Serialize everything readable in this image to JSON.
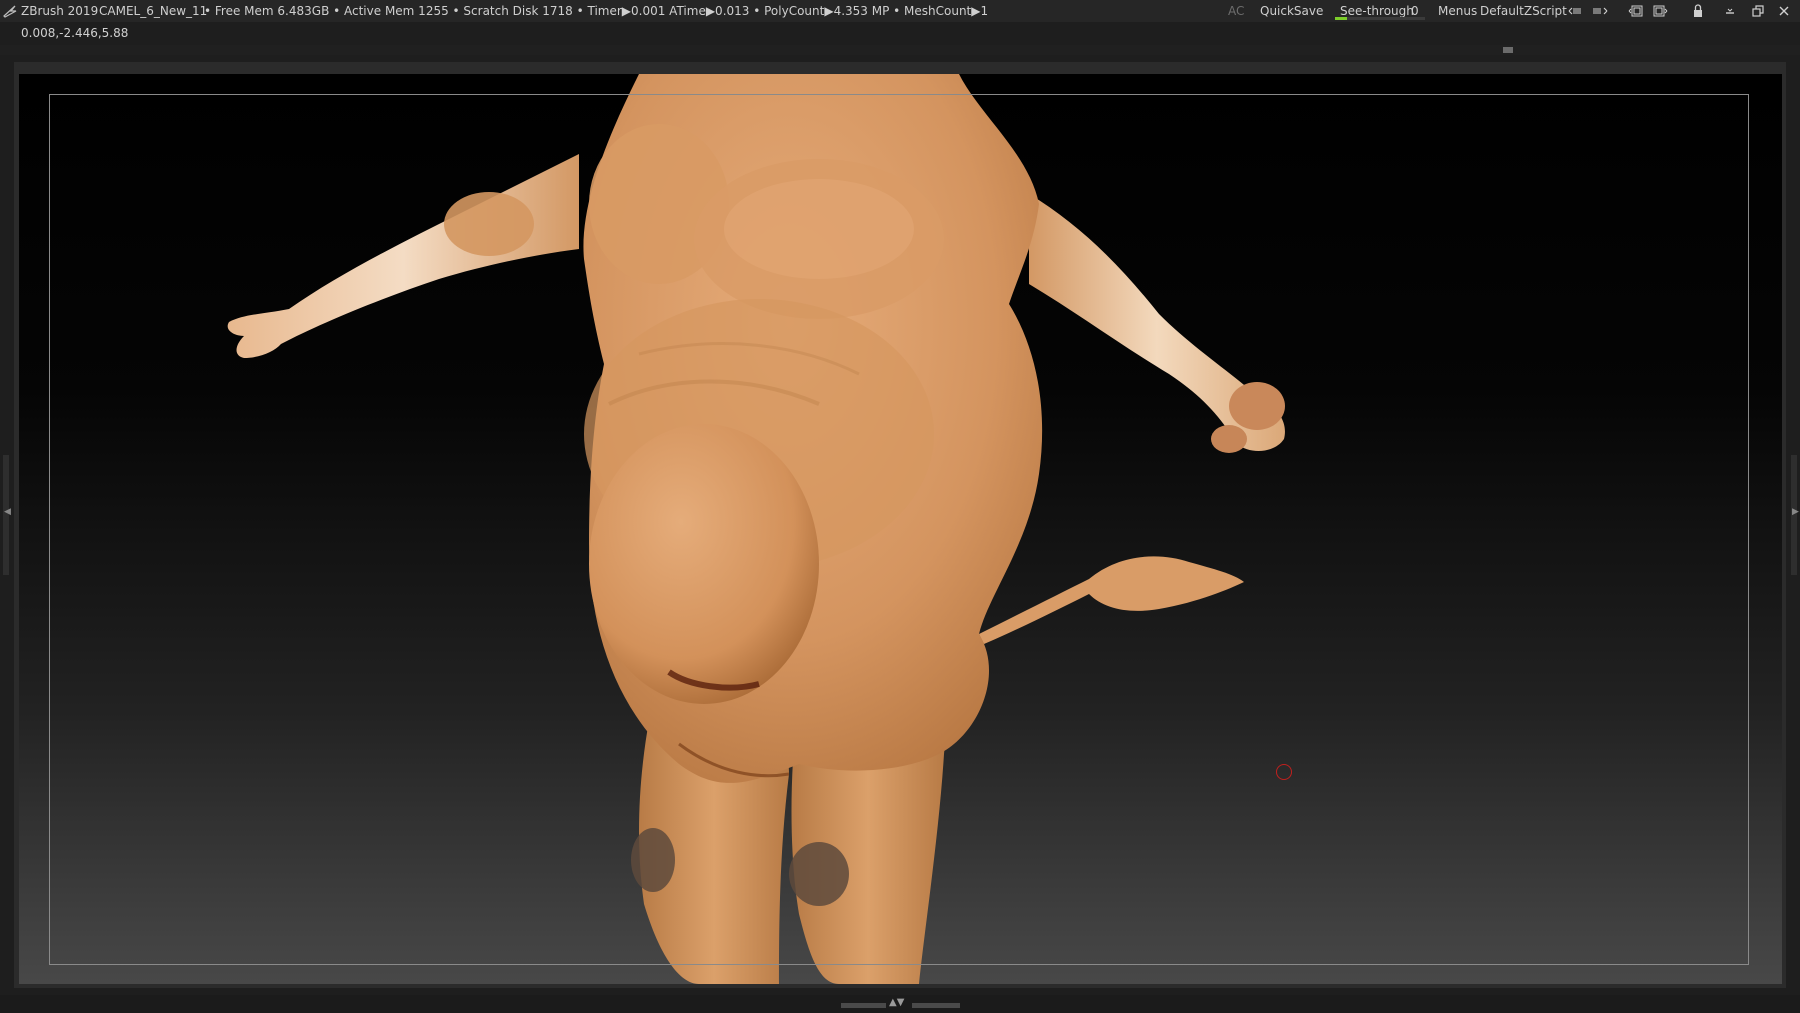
{
  "titlebar": {
    "app_name": "ZBrush 2019",
    "document_name": "CAMEL_6_New_11",
    "stats": "• Free Mem 6.483GB • Active Mem 1255 • Scratch Disk 1718 •  Timer▶0.001 ATime▶0.013 • PolyCount▶4.353 MP  • MeshCount▶1",
    "ac_label": "AC",
    "quicksave_label": "QuickSave",
    "seethrough_label": "See-through",
    "seethrough_value": "0",
    "menus_label": "Menus",
    "zscript_label": "DefaultZScript"
  },
  "coord_readout": "0.008,-2.446,5.88",
  "colors": {
    "skin": "#d4945f",
    "skin_highlight": "#e9b787",
    "skin_light_arm": "#f3d9bd",
    "hoof": "#5e4a3c",
    "background_top": "#000000",
    "background_bottom": "#484848",
    "accent_green": "#7ccd2a",
    "cursor_red": "#c0201e"
  }
}
